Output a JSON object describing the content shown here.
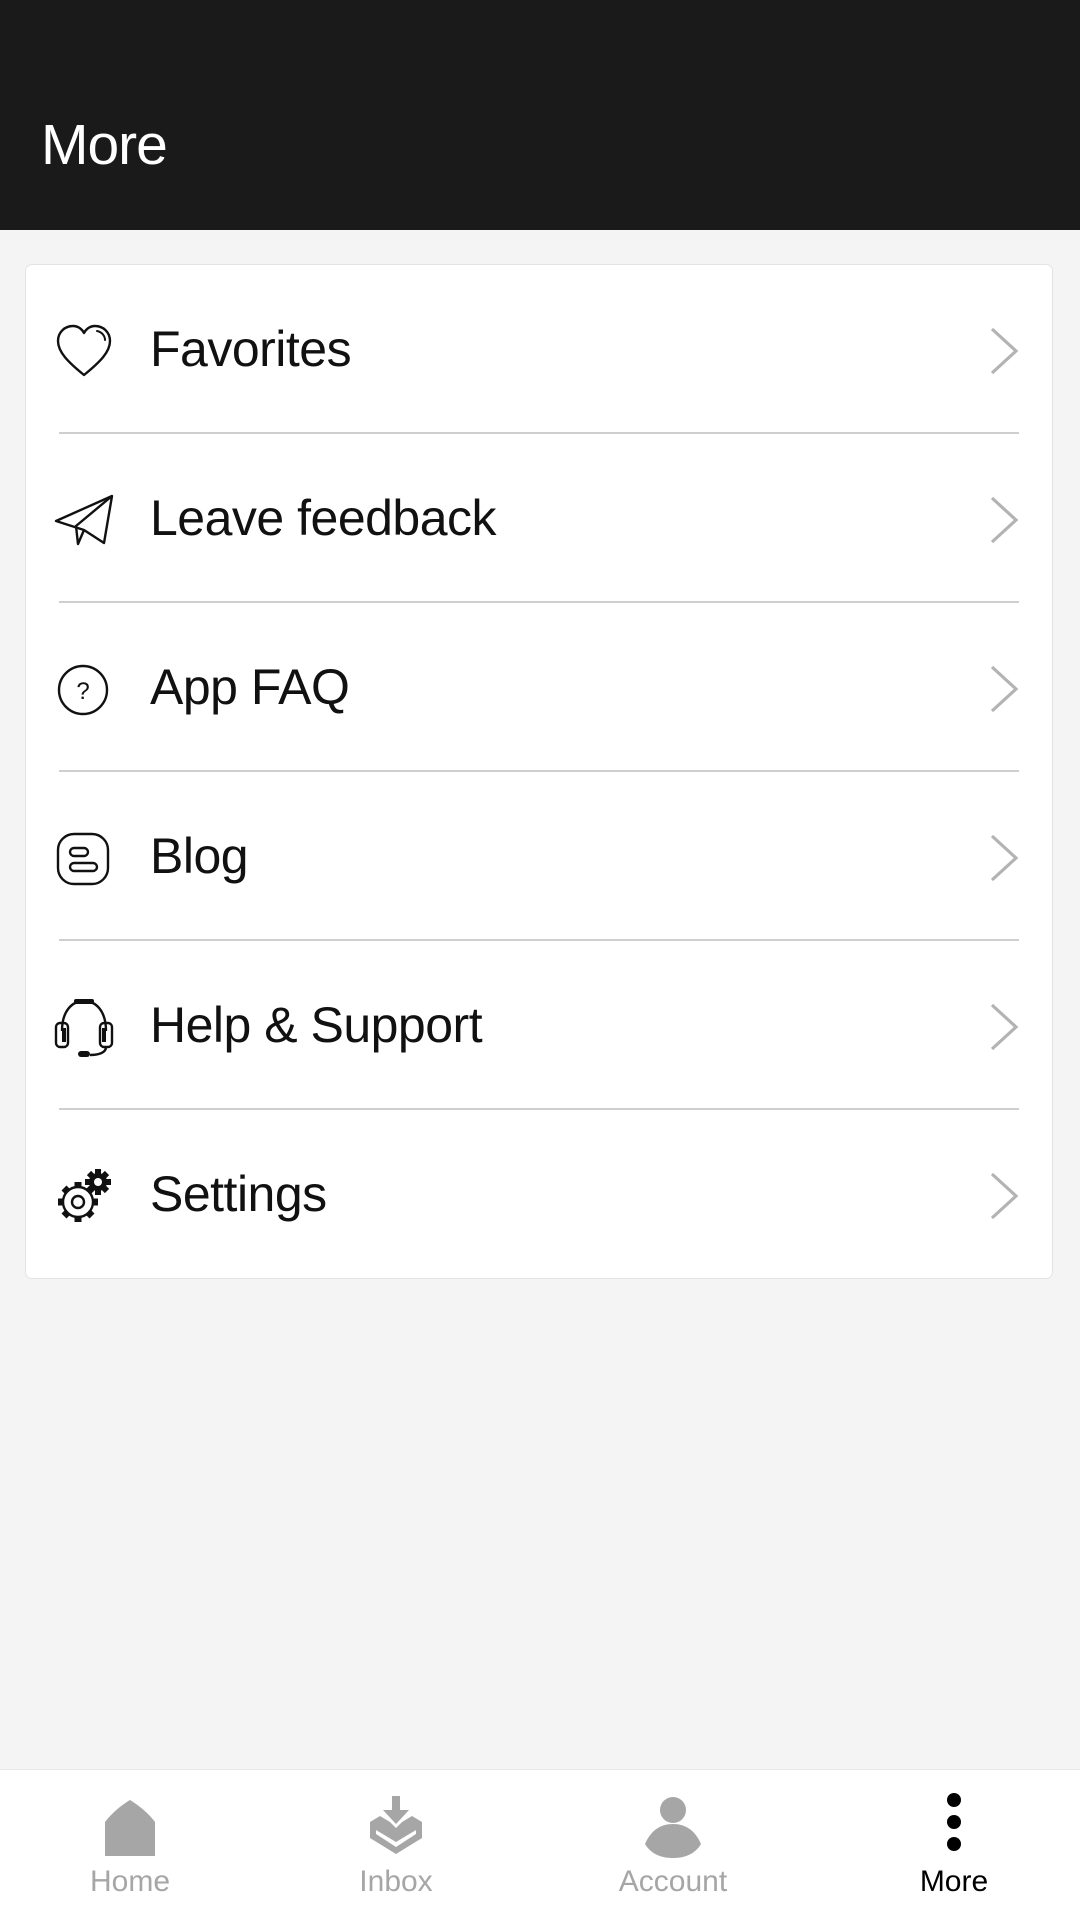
{
  "header": {
    "title": "More"
  },
  "menu": {
    "items": [
      {
        "label": "Favorites",
        "icon": "heart-icon"
      },
      {
        "label": "Leave feedback",
        "icon": "paper-plane-icon"
      },
      {
        "label": "App FAQ",
        "icon": "question-circle-icon"
      },
      {
        "label": "Blog",
        "icon": "blogger-icon"
      },
      {
        "label": "Help & Support",
        "icon": "headset-icon"
      },
      {
        "label": "Settings",
        "icon": "gears-icon"
      }
    ],
    "chevron_icon": "chevron-right-icon"
  },
  "bottom_nav": {
    "items": [
      {
        "label": "Home",
        "icon": "home-icon",
        "active": false
      },
      {
        "label": "Inbox",
        "icon": "inbox-download-icon",
        "active": false
      },
      {
        "label": "Account",
        "icon": "person-icon",
        "active": false
      },
      {
        "label": "More",
        "icon": "vertical-dots-icon",
        "active": true
      }
    ]
  },
  "colors": {
    "header_bg": "#1a1a1a",
    "page_bg": "#f4f4f4",
    "inactive_nav": "#a6a6a6",
    "active_nav": "#000000",
    "chevron": "#b3b3b3"
  }
}
